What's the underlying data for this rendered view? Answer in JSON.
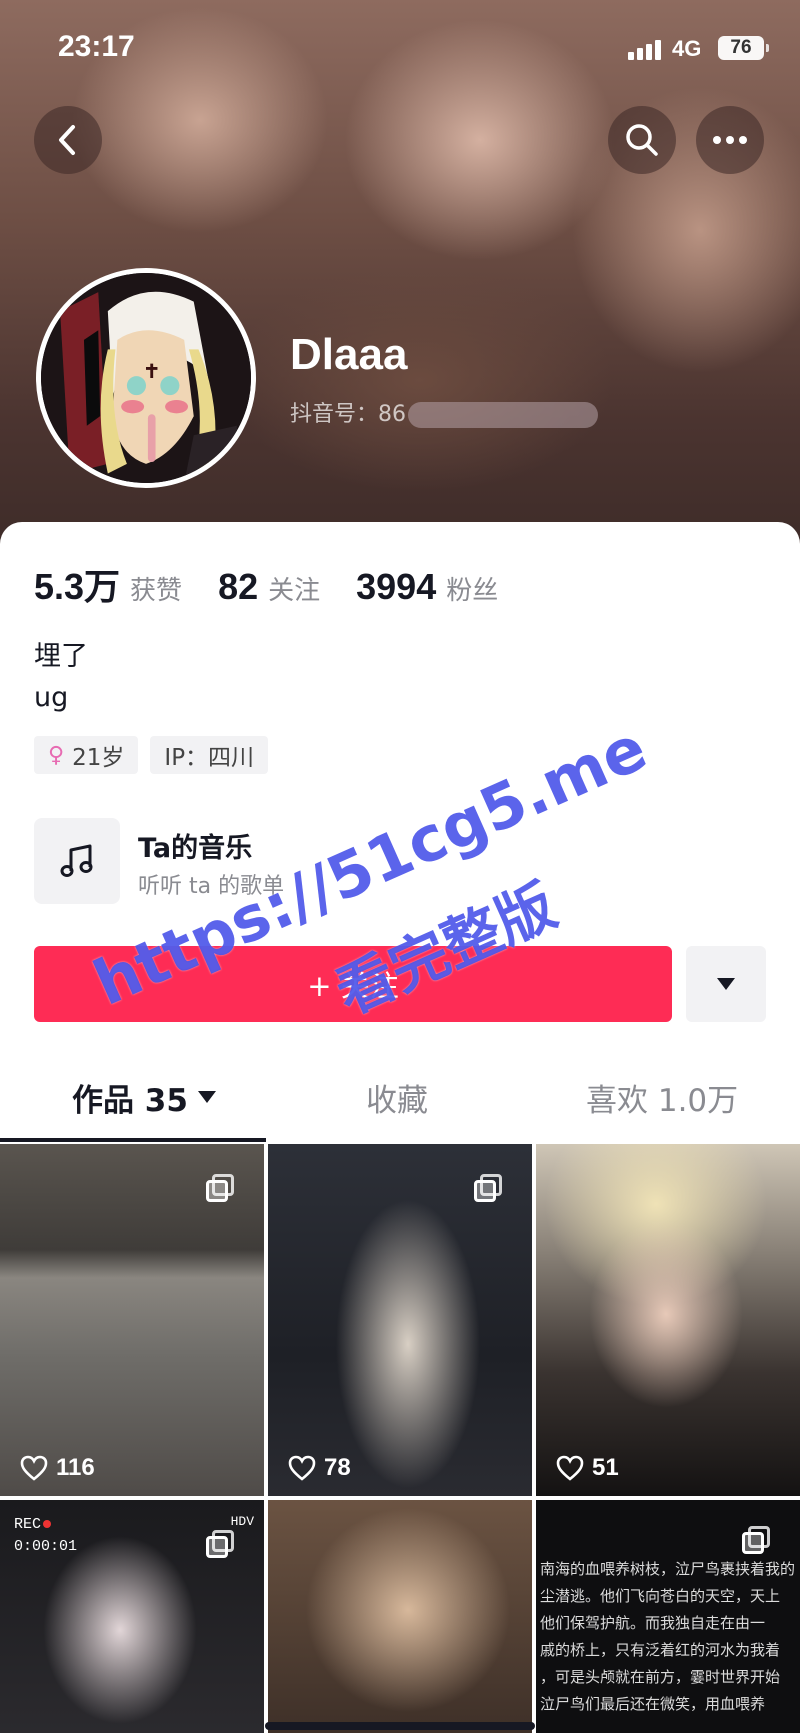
{
  "status_bar": {
    "time": "23:17",
    "network": "4G",
    "battery": "76"
  },
  "header": {
    "back_icon": "chevron-left-icon",
    "search_icon": "search-icon",
    "more_icon": "more-dots-icon"
  },
  "profile": {
    "username": "Dlaaa",
    "douyin_id_label": "抖音号：86",
    "stats": [
      {
        "value": "5.3万",
        "label": "获赞"
      },
      {
        "value": "82",
        "label": "关注"
      },
      {
        "value": "3994",
        "label": "粉丝"
      }
    ],
    "bio_line1": "埋了",
    "bio_line2": "ug",
    "tags": {
      "age": "21岁",
      "ip": "IP：四川"
    },
    "music": {
      "title": "Ta的音乐",
      "subtitle": "听听 ta 的歌单"
    }
  },
  "actions": {
    "follow_label": "+ 关注"
  },
  "tabs": {
    "works": "作品 35",
    "collections": "收藏",
    "likes": "喜欢 1.0万"
  },
  "grid": {
    "posts": [
      {
        "likes": "116",
        "multi": true
      },
      {
        "likes": "78",
        "multi": true
      },
      {
        "likes": "51",
        "multi": false
      },
      {
        "likes": "",
        "multi": true,
        "overlay_rec": "REC",
        "overlay_time": "0:00:01",
        "overlay_hdv": "HDV"
      },
      {
        "likes": "",
        "multi": false
      },
      {
        "likes": "",
        "multi": true,
        "text_lines": [
          "南海的血喂养树枝，泣尸鸟裹挟着我的",
          "尘潜逃。他们飞向苍白的天空，天上",
          "他们保驾护航。而我独自走在由一",
          "戚的桥上，只有泛着红的河水为我着",
          "，可是头颅就在前方，霎时世界开始",
          "泣尸鸟们最后还在微笑，用血喂养"
        ]
      }
    ]
  },
  "watermark": {
    "line1": "https://51cg5.me",
    "line2": "看完整版"
  },
  "colors": {
    "accent": "#fe2c55",
    "text_primary": "#161823",
    "text_secondary": "#8a8b91",
    "watermark": "#444ee8"
  }
}
